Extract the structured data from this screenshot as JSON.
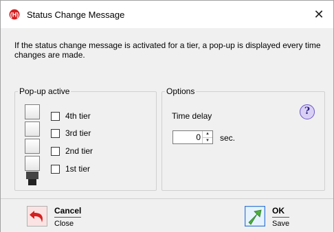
{
  "window": {
    "title": "Status Change Message",
    "close_glyph": "✕"
  },
  "message": "If the status change message is activated for a tier, a pop-up is displayed every time changes are made.",
  "popup_group": {
    "legend": "Pop-up active",
    "tiers": [
      {
        "label": "4th tier",
        "checked": false
      },
      {
        "label": "3rd tier",
        "checked": false
      },
      {
        "label": "2nd tier",
        "checked": false
      },
      {
        "label": "1st tier",
        "checked": false
      }
    ]
  },
  "options_group": {
    "legend": "Options",
    "time_delay_label": "Time delay",
    "time_delay_value": "0",
    "unit": "sec.",
    "help_icon": "question-mark-icon"
  },
  "footer": {
    "cancel": {
      "label": "Cancel",
      "sub": "Close",
      "icon": "undo-arrow-icon"
    },
    "ok": {
      "label": "OK",
      "sub": "Save",
      "icon": "green-arrow-icon"
    }
  },
  "colors": {
    "accent_red": "#d42020",
    "ok_green": "#4caf3a",
    "help_purple": "#6a55c8"
  }
}
